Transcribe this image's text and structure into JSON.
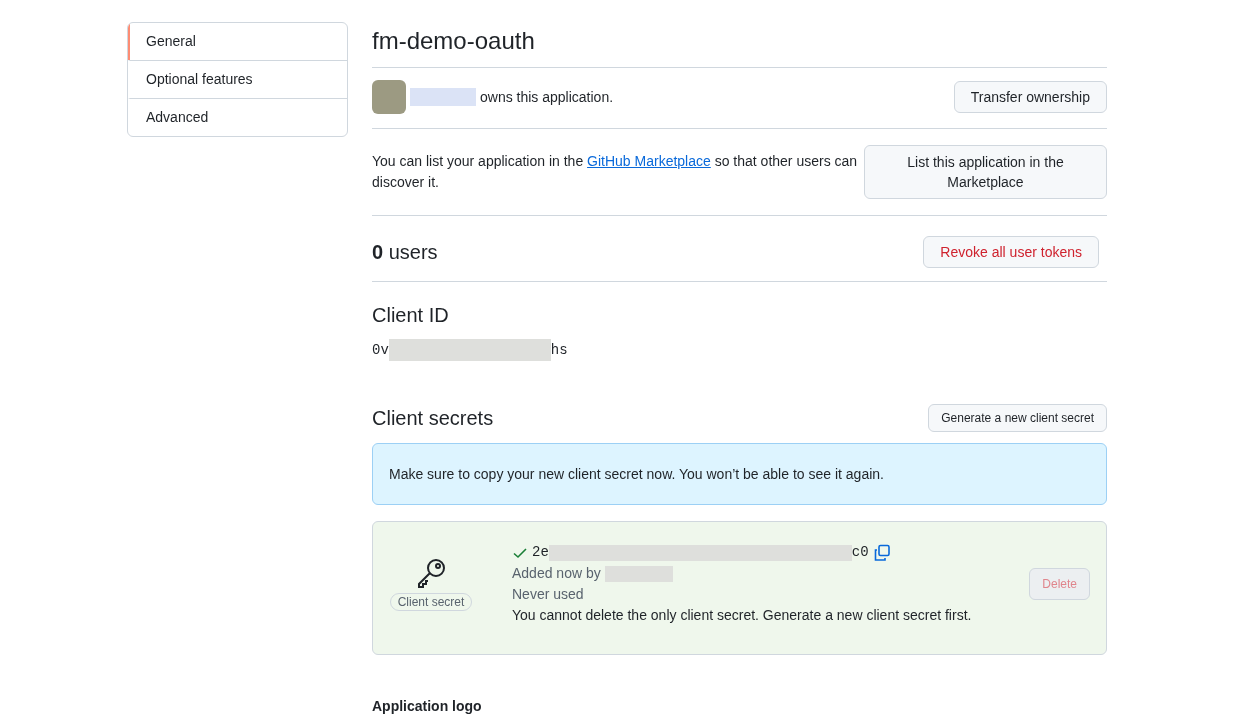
{
  "sidebar": {
    "items": [
      {
        "label": "General",
        "selected": true
      },
      {
        "label": "Optional features",
        "selected": false
      },
      {
        "label": "Advanced",
        "selected": false
      }
    ]
  },
  "title": "fm-demo-oauth",
  "owner": {
    "text": "owns this application.",
    "button": "Transfer ownership"
  },
  "marketplace": {
    "before": "You can list your application in the ",
    "link": "GitHub Marketplace",
    "after": " so that other users can discover it.",
    "button": "List this application in the Marketplace"
  },
  "users": {
    "count": "0",
    "label": "users",
    "button": "Revoke all user tokens"
  },
  "client_id": {
    "heading": "Client ID",
    "start": "0v",
    "end": "hs"
  },
  "client_secrets": {
    "heading": "Client secrets",
    "button": "Generate a new client secret",
    "notice": "Make sure to copy your new client secret now. You won’t be able to see it again.",
    "secret": {
      "badge": "Client secret",
      "start": "2e",
      "end": "c0",
      "added": "Added now by",
      "usage": "Never used",
      "note": "You cannot delete the only client secret. Generate a new client secret first.",
      "delete_button": "Delete",
      "delete_disabled": true
    }
  },
  "logo_heading": "Application logo"
}
